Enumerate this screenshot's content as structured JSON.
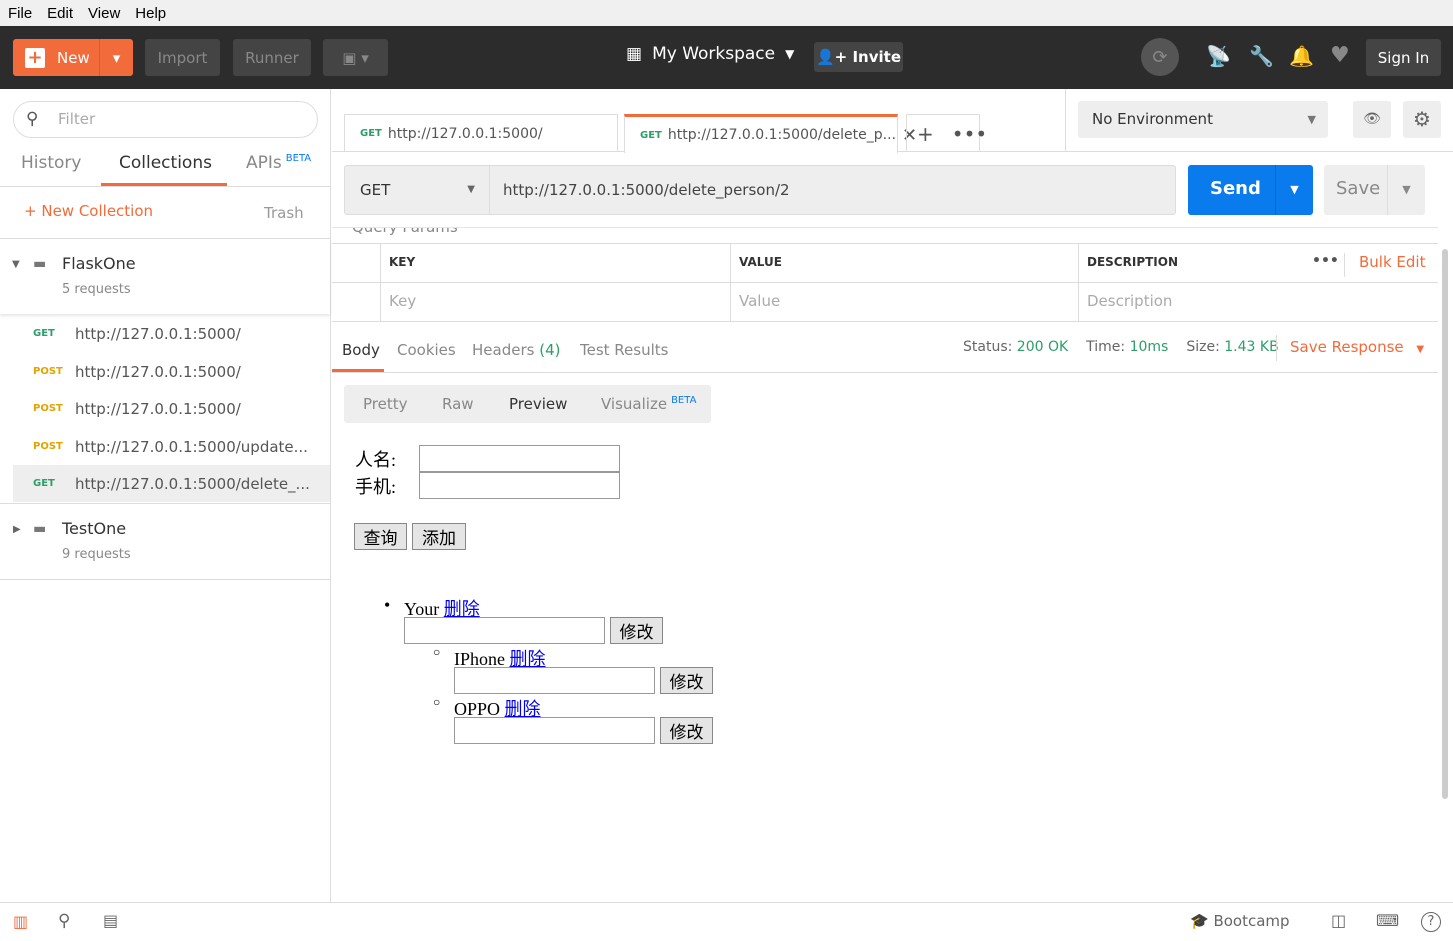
{
  "menu": [
    "File",
    "Edit",
    "View",
    "Help"
  ],
  "header": {
    "new": "New",
    "import": "Import",
    "runner": "Runner",
    "workspace": "My Workspace",
    "invite": "Invite",
    "sign_in": "Sign In"
  },
  "sidebar": {
    "filter_placeholder": "Filter",
    "tabs": {
      "history": "History",
      "collections": "Collections",
      "apis": "APIs",
      "beta": "BETA"
    },
    "new_collection": "New Collection",
    "trash": "Trash",
    "collections": [
      {
        "name": "FlaskOne",
        "count": "5 requests"
      },
      {
        "name": "TestOne",
        "count": "9 requests"
      }
    ],
    "requests": [
      {
        "method": "GET",
        "url": "http://127.0.0.1:5000/"
      },
      {
        "method": "POST",
        "url": "http://127.0.0.1:5000/"
      },
      {
        "method": "POST",
        "url": "http://127.0.0.1:5000/"
      },
      {
        "method": "POST",
        "url": "http://127.0.0.1:5000/update..."
      },
      {
        "method": "GET",
        "url": "http://127.0.0.1:5000/delete_..."
      }
    ]
  },
  "tabs": [
    {
      "method": "GET",
      "url": "http://127.0.0.1:5000/"
    },
    {
      "method": "GET",
      "url": "http://127.0.0.1:5000/delete_p..."
    }
  ],
  "environment": "No Environment",
  "request": {
    "method": "GET",
    "url": "http://127.0.0.1:5000/delete_person/2",
    "send": "Send",
    "save": "Save",
    "query_params": "Query Params"
  },
  "params": {
    "headers": [
      "KEY",
      "VALUE",
      "DESCRIPTION"
    ],
    "placeholders": [
      "Key",
      "Value",
      "Description"
    ],
    "bulk_edit": "Bulk Edit"
  },
  "response": {
    "tabs": [
      "Body",
      "Cookies",
      "Headers",
      "Test Results"
    ],
    "headers_count": "(4)",
    "status_label": "Status:",
    "status": "200 OK",
    "time_label": "Time:",
    "time": "10ms",
    "size_label": "Size:",
    "size": "1.43 KB",
    "save_response": "Save Response",
    "views": [
      "Pretty",
      "Raw",
      "Preview",
      "Visualize"
    ],
    "beta": "BETA"
  },
  "preview": {
    "name_label": "人名:",
    "phone_label": "手机:",
    "query": "查询",
    "add": "添加",
    "delete": "删除",
    "modify": "修改",
    "items": [
      {
        "name": "Your"
      },
      {
        "name": "IPhone"
      },
      {
        "name": "OPPO"
      }
    ]
  },
  "footer": {
    "bootcamp": "Bootcamp"
  },
  "colors": {
    "accent": "#f26b3a",
    "send": "#097bed",
    "success": "#2b9e69",
    "post": "#e3a300"
  }
}
